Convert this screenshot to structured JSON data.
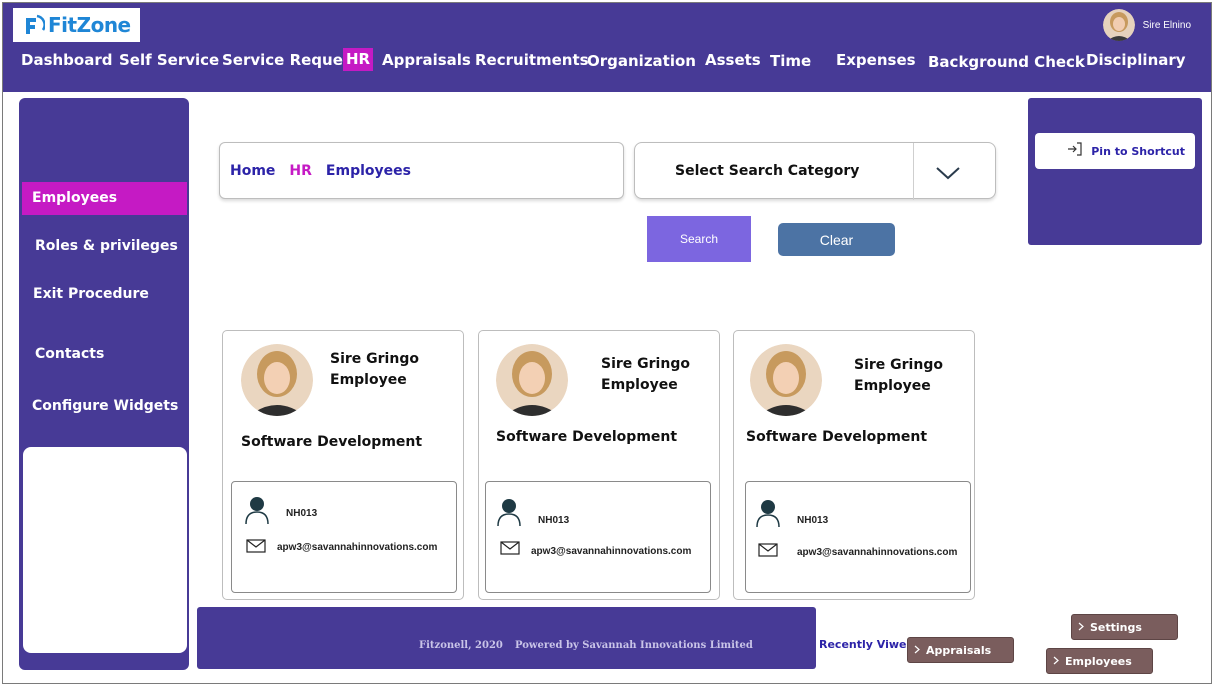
{
  "app": {
    "logo_text": "FitZone",
    "brand_color": "#473a96",
    "accent_color": "#c51ac4"
  },
  "user": {
    "name": "Sire Elnino"
  },
  "nav": [
    {
      "label": "Dashboard"
    },
    {
      "label": "Self Service"
    },
    {
      "label": "Service Request"
    },
    {
      "label": "HR",
      "active": true
    },
    {
      "label": "Appraisals"
    },
    {
      "label": "Recruitments"
    },
    {
      "label": "Organization"
    },
    {
      "label": "Assets"
    },
    {
      "label": "Time"
    },
    {
      "label": "Expenses"
    },
    {
      "label": "Background Check"
    },
    {
      "label": "Disciplinary"
    }
  ],
  "sidebar": {
    "items": [
      {
        "label": "Employees",
        "active": true
      },
      {
        "label": "Roles & privileges"
      },
      {
        "label": "Exit Procedure"
      },
      {
        "label": "Contacts"
      },
      {
        "label": "Configure Widgets"
      }
    ]
  },
  "breadcrumb": {
    "home": "Home",
    "section": "HR",
    "page": "Employees"
  },
  "search": {
    "category_label": "Select Search Category",
    "search_label": "Search",
    "clear_label": "Clear"
  },
  "pin": {
    "label": "Pin to Shortcut"
  },
  "employees": [
    {
      "name": "Sire Gringo",
      "role": "Employee",
      "department": "Software Development",
      "code": "NH013",
      "email": "apw3@savannahinnovations.com"
    },
    {
      "name": "Sire Gringo",
      "role": "Employee",
      "department": "Software Development",
      "code": "NH013",
      "email": "apw3@savannahinnovations.com"
    },
    {
      "name": "Sire Gringo",
      "role": "Employee",
      "department": "Software Development",
      "code": "NH013",
      "email": "apw3@savannahinnovations.com"
    }
  ],
  "footer": {
    "copyright": "Fitzonell, 2020",
    "powered": "Powered by Savannah Innovations Limited"
  },
  "recent": {
    "label": "Recently Viwed",
    "chips": [
      {
        "label": "Settings"
      },
      {
        "label": "Appraisals"
      },
      {
        "label": "Employees"
      }
    ]
  }
}
